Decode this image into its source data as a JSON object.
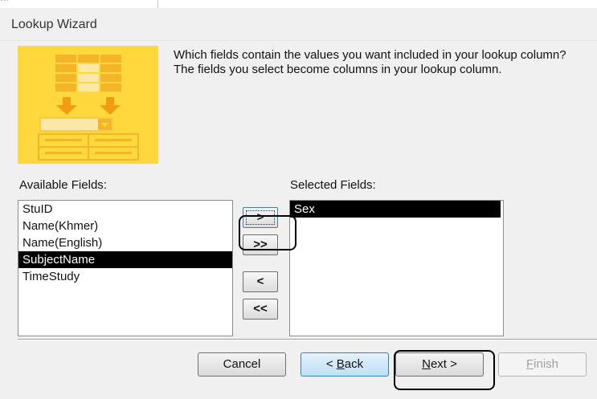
{
  "top_fragment": "··· ",
  "dialog": {
    "title": "Lookup Wizard",
    "instructions": "Which fields contain the values you want included in your lookup column? The fields you select become columns in your lookup column."
  },
  "available_fields": {
    "label": "Available Fields:",
    "items": [
      "StuID",
      "Name(Khmer)",
      "Name(English)",
      "SubjectName",
      "TimeStudy"
    ],
    "selected_index": 3
  },
  "selected_fields": {
    "label": "Selected Fields:",
    "items": [
      "Sex"
    ],
    "selected_index": 0
  },
  "move_buttons": {
    "add": ">",
    "add_all": ">>",
    "remove": "<",
    "remove_all": "<<"
  },
  "footer": {
    "cancel": "Cancel",
    "back_prefix": "< ",
    "back_accel": "B",
    "back_rest": "ack",
    "next_accel": "N",
    "next_rest": "ext >",
    "finish_accel": "F",
    "finish_rest": "inish"
  },
  "colors": {
    "dialog_bg": "#f0f0f0",
    "wizard_image_bg": "#ffd83e",
    "selection_bg": "#000000"
  }
}
